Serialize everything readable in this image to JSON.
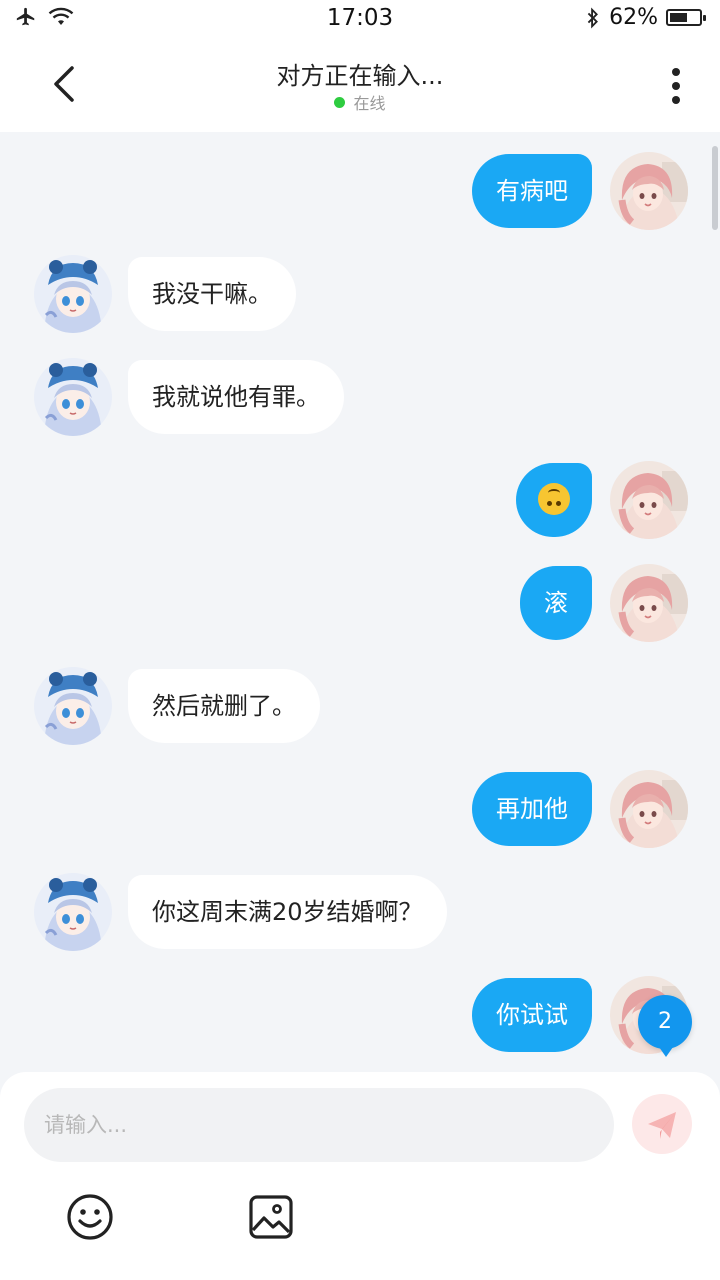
{
  "status_bar": {
    "time": "17:03",
    "battery_percent": "62%",
    "battery_level": 0.62,
    "icons": [
      "airplane-icon",
      "wifi-icon",
      "bluetooth-icon",
      "battery-icon"
    ]
  },
  "header": {
    "title": "对方正在输入...",
    "status": "在线",
    "status_color": "#2ecc40",
    "back_icon": "chevron-left-icon",
    "menu_icon": "more-vertical-icon"
  },
  "messages": [
    {
      "side": "out",
      "text": "有病吧"
    },
    {
      "side": "in",
      "text": "我没干嘛。"
    },
    {
      "side": "in",
      "text": "我就说他有罪。"
    },
    {
      "side": "out",
      "text": "",
      "emoji": "upside-down-face-emoji"
    },
    {
      "side": "out",
      "text": "滚"
    },
    {
      "side": "in",
      "text": "然后就删了。"
    },
    {
      "side": "out",
      "text": "再加他"
    },
    {
      "side": "in",
      "text": "你这周末满20岁结婚啊？"
    },
    {
      "side": "out",
      "text": "你试试"
    }
  ],
  "unread_badge": "2",
  "composer": {
    "placeholder": "请输入...",
    "send_icon": "send-icon",
    "tools": [
      "smiley-icon",
      "image-icon"
    ]
  },
  "colors": {
    "outgoing_bubble": "#1aa8f4",
    "incoming_bubble": "#ffffff",
    "chat_background": "#f3f5f8",
    "badge": "#1296ee"
  }
}
